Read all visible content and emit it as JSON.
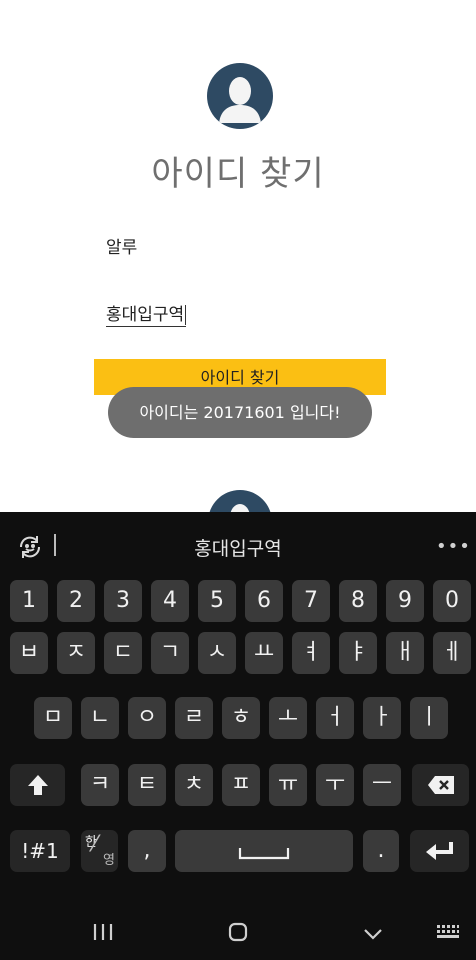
{
  "screen": {
    "title": "아이디 찾기",
    "name_value": "알루",
    "station_value": "홍대입구역",
    "find_button_label": "아이디 찾기",
    "toast_message": "아이디는 20171601 입니다!"
  },
  "keyboard": {
    "suggestion": "홍대입구역",
    "more_label": "•••",
    "row_numbers": [
      "1",
      "2",
      "3",
      "4",
      "5",
      "6",
      "7",
      "8",
      "9",
      "0"
    ],
    "row_1": [
      "ㅂ",
      "ㅈ",
      "ㄷ",
      "ㄱ",
      "ㅅ",
      "ㅛ",
      "ㅕ",
      "ㅑ",
      "ㅐ",
      "ㅔ"
    ],
    "row_2": [
      "ㅁ",
      "ㄴ",
      "ㅇ",
      "ㄹ",
      "ㅎ",
      "ㅗ",
      "ㅓ",
      "ㅏ",
      "ㅣ"
    ],
    "row_3": [
      "ㅋ",
      "ㅌ",
      "ㅊ",
      "ㅍ",
      "ㅠ",
      "ㅜ",
      "ㅡ"
    ],
    "symbols_label": "!#1",
    "lang_top": "한",
    "lang_bottom": "영",
    "comma_label": ",",
    "period_label": "."
  },
  "colors": {
    "accent_button": "#fbbf13",
    "avatar": "#2e4a63",
    "toast_bg": "#6e6e6e",
    "keyboard_bg": "#0f0f0f",
    "key_bg": "#3a3a3a"
  }
}
